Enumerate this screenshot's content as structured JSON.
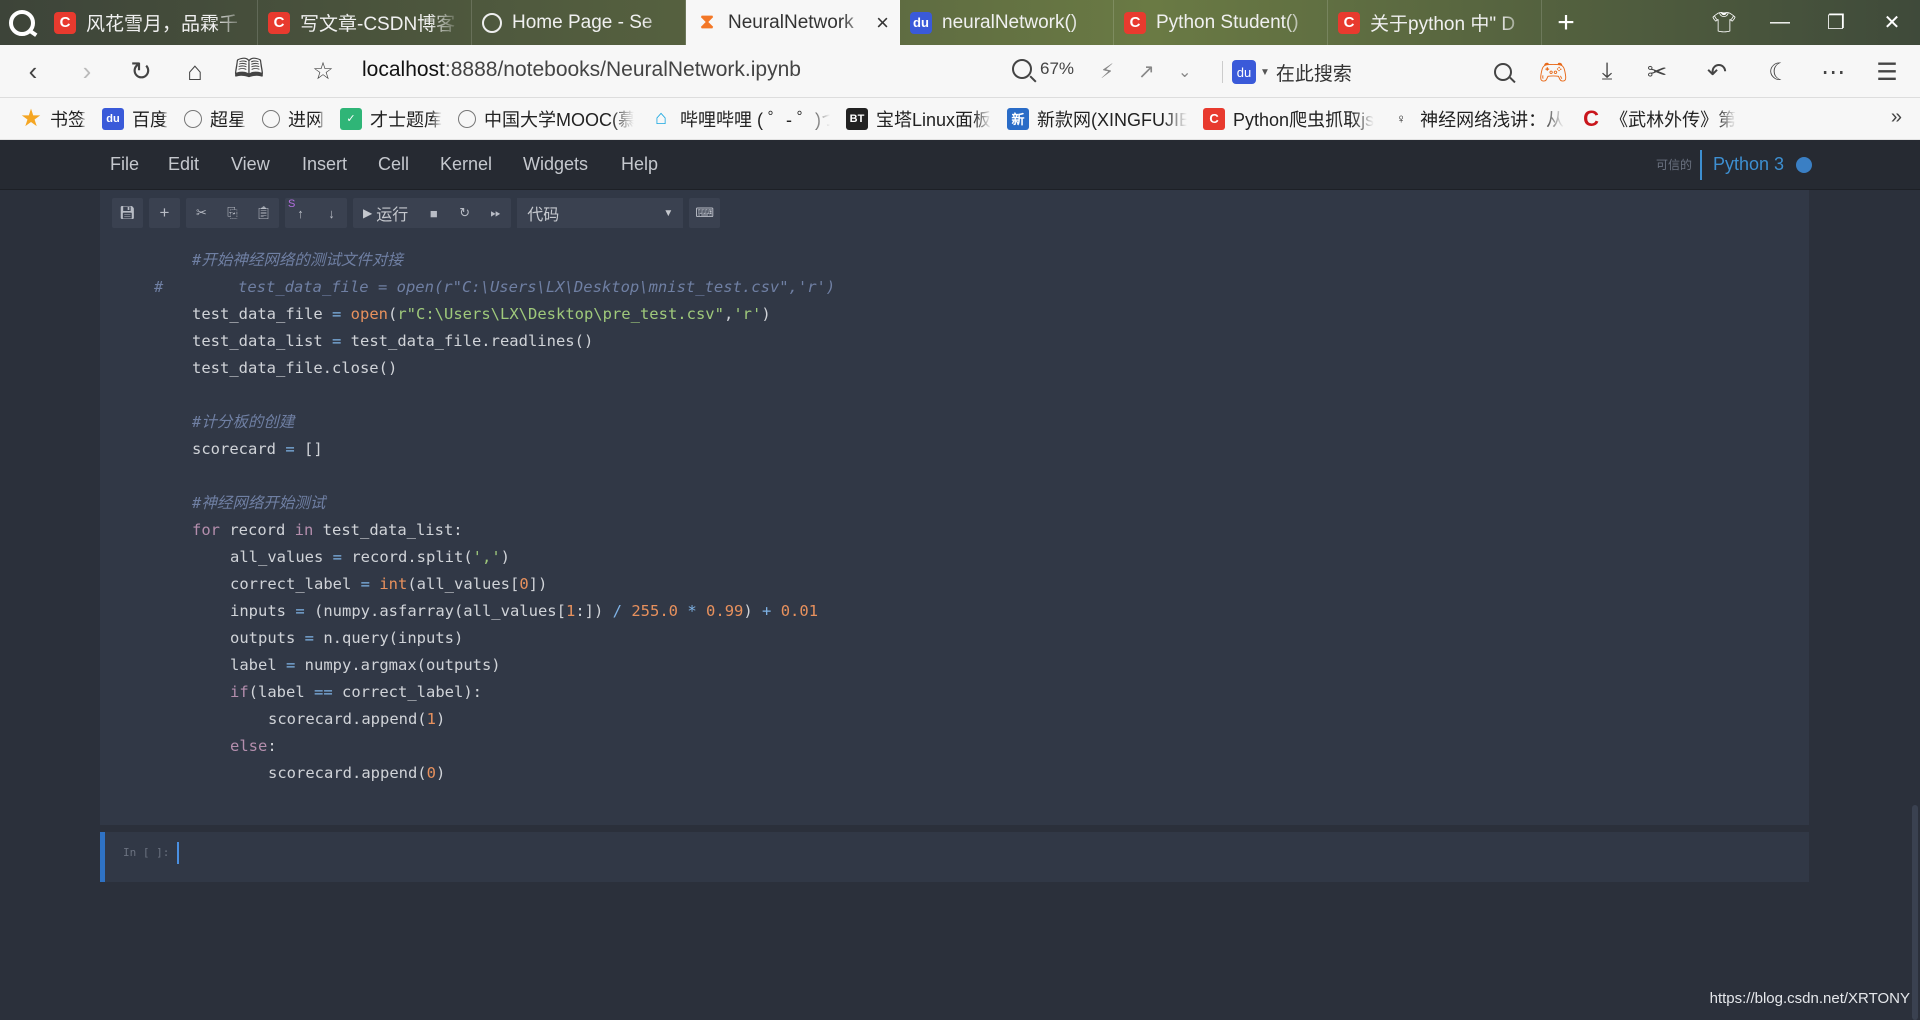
{
  "tabs": [
    {
      "label": "风花雪月，品霖千",
      "icon": "csdn-icon"
    },
    {
      "label": "写文章-CSDN博客",
      "icon": "csdn-icon"
    },
    {
      "label": "Home Page - Se",
      "icon": "home-icon"
    },
    {
      "label": "NeuralNetwork",
      "icon": "jupyter-icon",
      "active": true
    },
    {
      "label": "neuralNetwork()",
      "icon": "baidu-icon"
    },
    {
      "label": "Python Student()",
      "icon": "csdn-icon"
    },
    {
      "label": "关于python 中\" D",
      "icon": "csdn-icon"
    }
  ],
  "address": {
    "host": "localhost",
    "path": ":8888/notebooks/NeuralNetwork.ipynb",
    "zoom": "67%",
    "search_placeholder": "在此搜索"
  },
  "bookmarks": [
    {
      "label": "书签",
      "icon": "star-icon"
    },
    {
      "label": "百度",
      "icon": "baidu-icon"
    },
    {
      "label": "超星",
      "icon": "globe-icon"
    },
    {
      "label": "进网",
      "icon": "globe-icon"
    },
    {
      "label": "才士题库",
      "icon": "green-icon"
    },
    {
      "label": "中国大学MOOC(慕",
      "icon": "globe-icon"
    },
    {
      "label": "哔哩哔哩 ( ゜- ゜)つ",
      "icon": "bilibili-icon"
    },
    {
      "label": "宝塔Linux面板",
      "icon": "bt-icon"
    },
    {
      "label": "新款网(XINGFUJIE",
      "icon": "xin-icon"
    },
    {
      "label": "Python爬虫抓取js",
      "icon": "csdn-icon"
    },
    {
      "label": "神经网络浅讲：从",
      "icon": "person-icon"
    },
    {
      "label": "《武林外传》第",
      "icon": "wuxia-icon"
    }
  ],
  "jupyter": {
    "menu": [
      "File",
      "Edit",
      "View",
      "Insert",
      "Cell",
      "Kernel",
      "Widgets",
      "Help"
    ],
    "trusted": "可信的",
    "kernel": "Python 3",
    "run_label": "运行",
    "cell_type": "代码",
    "s_mark": "S",
    "empty_prompt": "In [ ]:"
  },
  "code_lines": [
    {
      "indent": 0,
      "tokens": [
        [
          "cm",
          "#开始神经网络的测试文件对接"
        ]
      ]
    },
    {
      "indent": -1,
      "tokens": [
        [
          "cm",
          "#        test_data_file = open(r\"C:\\Users\\LX\\Desktop\\mnist_test.csv\",'r')"
        ]
      ]
    },
    {
      "indent": 0,
      "tokens": [
        [
          "tx",
          "test_data_file "
        ],
        [
          "op",
          "="
        ],
        [
          "tx",
          " "
        ],
        [
          "bi",
          "open"
        ],
        [
          "tx",
          "("
        ],
        [
          "st",
          "r\"C:\\Users\\LX\\Desktop\\pre_test.csv\""
        ],
        [
          "tx",
          ","
        ],
        [
          "st",
          "'r'"
        ],
        [
          "tx",
          ")"
        ]
      ]
    },
    {
      "indent": 0,
      "tokens": [
        [
          "tx",
          "test_data_list "
        ],
        [
          "op",
          "="
        ],
        [
          "tx",
          " test_data_file.readlines()"
        ]
      ]
    },
    {
      "indent": 0,
      "tokens": [
        [
          "tx",
          "test_data_file.close()"
        ]
      ]
    },
    {
      "indent": 0,
      "tokens": []
    },
    {
      "indent": 0,
      "tokens": [
        [
          "cm",
          "#计分板的创建"
        ]
      ]
    },
    {
      "indent": 0,
      "tokens": [
        [
          "tx",
          "scorecard "
        ],
        [
          "op",
          "="
        ],
        [
          "tx",
          " []"
        ]
      ]
    },
    {
      "indent": 0,
      "tokens": []
    },
    {
      "indent": 0,
      "tokens": [
        [
          "cm",
          "#神经网络开始测试"
        ]
      ]
    },
    {
      "indent": 0,
      "tokens": [
        [
          "kw",
          "for"
        ],
        [
          "tx",
          " record "
        ],
        [
          "kw",
          "in"
        ],
        [
          "tx",
          " test_data_list:"
        ]
      ]
    },
    {
      "indent": 1,
      "tokens": [
        [
          "tx",
          "all_values "
        ],
        [
          "op",
          "="
        ],
        [
          "tx",
          " record.split("
        ],
        [
          "st",
          "','"
        ],
        [
          "tx",
          ")"
        ]
      ]
    },
    {
      "indent": 1,
      "tokens": [
        [
          "tx",
          "correct_label "
        ],
        [
          "op",
          "="
        ],
        [
          "tx",
          " "
        ],
        [
          "bi",
          "int"
        ],
        [
          "tx",
          "(all_values["
        ],
        [
          "nu",
          "0"
        ],
        [
          "tx",
          "])"
        ]
      ]
    },
    {
      "indent": 1,
      "tokens": [
        [
          "tx",
          "inputs "
        ],
        [
          "op",
          "="
        ],
        [
          "tx",
          " (numpy.asfarray(all_values["
        ],
        [
          "nu",
          "1"
        ],
        [
          "tx",
          ":]) "
        ],
        [
          "op",
          "/"
        ],
        [
          "tx",
          " "
        ],
        [
          "nu",
          "255.0"
        ],
        [
          "tx",
          " "
        ],
        [
          "op",
          "*"
        ],
        [
          "tx",
          " "
        ],
        [
          "nu",
          "0.99"
        ],
        [
          "tx",
          ") "
        ],
        [
          "op",
          "+"
        ],
        [
          "tx",
          " "
        ],
        [
          "nu",
          "0.01"
        ]
      ]
    },
    {
      "indent": 1,
      "tokens": [
        [
          "tx",
          "outputs "
        ],
        [
          "op",
          "="
        ],
        [
          "tx",
          " n.query(inputs)"
        ]
      ]
    },
    {
      "indent": 1,
      "tokens": [
        [
          "tx",
          "label "
        ],
        [
          "op",
          "="
        ],
        [
          "tx",
          " numpy.argmax(outputs)"
        ]
      ]
    },
    {
      "indent": 1,
      "tokens": [
        [
          "kw",
          "if"
        ],
        [
          "tx",
          "(label "
        ],
        [
          "op",
          "=="
        ],
        [
          "tx",
          " correct_label):"
        ]
      ]
    },
    {
      "indent": 2,
      "tokens": [
        [
          "tx",
          "scorecard.append("
        ],
        [
          "nu",
          "1"
        ],
        [
          "tx",
          ")"
        ]
      ]
    },
    {
      "indent": 1,
      "tokens": [
        [
          "kw",
          "else"
        ],
        [
          "tx",
          ":"
        ]
      ]
    },
    {
      "indent": 2,
      "tokens": [
        [
          "tx",
          "scorecard.append("
        ],
        [
          "nu",
          "0"
        ],
        [
          "tx",
          ")"
        ]
      ]
    }
  ],
  "watermark": "https://blog.csdn.net/XRTONY"
}
